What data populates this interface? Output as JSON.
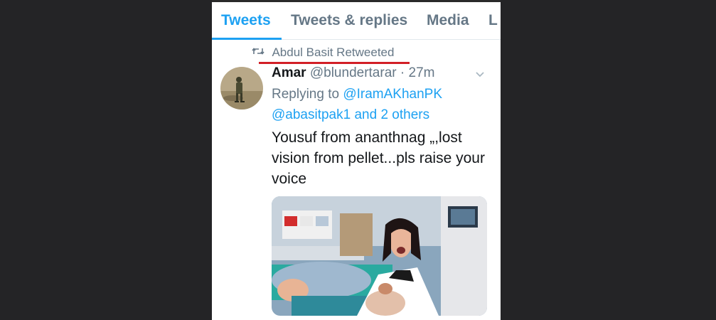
{
  "tabs": [
    {
      "label": "Tweets",
      "active": true
    },
    {
      "label": "Tweets & replies",
      "active": false
    },
    {
      "label": "Media",
      "active": false
    },
    {
      "label": "L",
      "active": false
    }
  ],
  "retweet": {
    "icon": "retweet-icon",
    "text": "Abdul Basit Retweeted"
  },
  "tweet": {
    "name": "Amar",
    "handle": "@blundertarar",
    "separator": " · ",
    "time": "27m",
    "replying_to_prefix": "Replying to ",
    "mention_1": "@IramAKhanPK",
    "mention_2": "@abasitpak1",
    "and_others": " and 2 others",
    "text": "Yousuf from ananthnag „,lost vision from pellet...pls raise your voice",
    "menu_icon": "chevron-down-icon"
  },
  "colors": {
    "accent": "#1da1f2",
    "muted": "#657786",
    "text": "#14171a",
    "annotation_red": "#d21f26",
    "backdrop": "#242426"
  }
}
